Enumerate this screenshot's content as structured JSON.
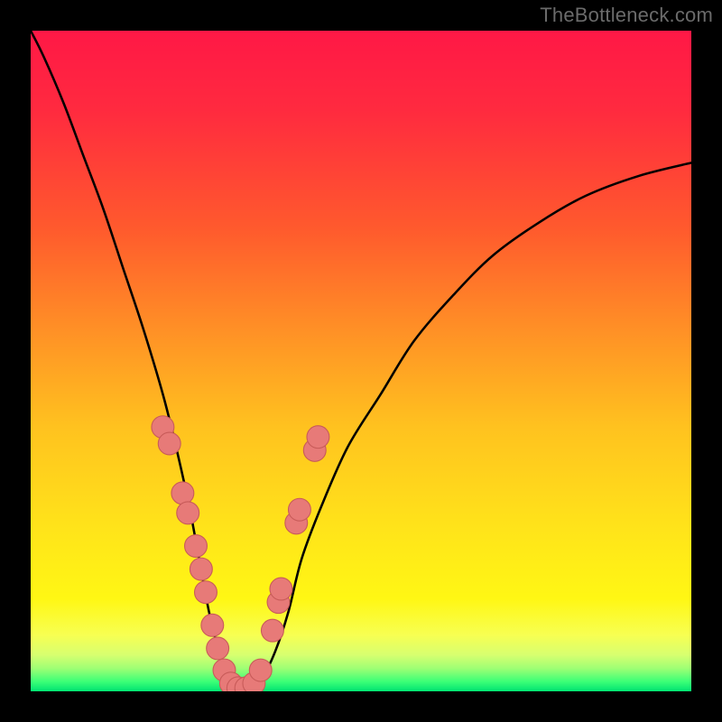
{
  "attribution": "TheBottleneck.com",
  "colors": {
    "frame": "#000000",
    "gradient_stops": [
      {
        "offset": 0.0,
        "color": "#ff1846"
      },
      {
        "offset": 0.12,
        "color": "#ff2a3f"
      },
      {
        "offset": 0.3,
        "color": "#ff5a2d"
      },
      {
        "offset": 0.45,
        "color": "#ff8f26"
      },
      {
        "offset": 0.6,
        "color": "#ffc21f"
      },
      {
        "offset": 0.75,
        "color": "#ffe31a"
      },
      {
        "offset": 0.86,
        "color": "#fff714"
      },
      {
        "offset": 0.915,
        "color": "#f7ff52"
      },
      {
        "offset": 0.945,
        "color": "#d7ff70"
      },
      {
        "offset": 0.965,
        "color": "#9fff74"
      },
      {
        "offset": 0.985,
        "color": "#3dff77"
      },
      {
        "offset": 1.0,
        "color": "#00e472"
      }
    ],
    "curve": "#000000",
    "marker_fill": "#e77a78",
    "marker_stroke": "#c85b59"
  },
  "chart_data": {
    "type": "line",
    "title": "",
    "xlabel": "",
    "ylabel": "",
    "xlim": [
      0,
      100
    ],
    "ylim": [
      0,
      100
    ],
    "series": [
      {
        "name": "bottleneck-curve",
        "x": [
          0,
          2,
          5,
          8,
          11,
          14,
          17,
          20,
          22,
          24,
          25.5,
          27,
          28.5,
          30,
          31.5,
          33,
          35,
          37,
          39,
          41,
          44,
          48,
          53,
          58,
          64,
          70,
          77,
          84,
          92,
          100
        ],
        "y": [
          100,
          96,
          89,
          81,
          73,
          64,
          55,
          45,
          37,
          28,
          20,
          12,
          6,
          2,
          0.5,
          0.5,
          2,
          6,
          12,
          20,
          28,
          37,
          45,
          53,
          60,
          66,
          71,
          75,
          78,
          80
        ]
      }
    ],
    "markers": [
      {
        "x": 20.0,
        "y": 40.0
      },
      {
        "x": 21.0,
        "y": 37.5
      },
      {
        "x": 23.0,
        "y": 30.0
      },
      {
        "x": 23.8,
        "y": 27.0
      },
      {
        "x": 25.0,
        "y": 22.0
      },
      {
        "x": 25.8,
        "y": 18.5
      },
      {
        "x": 26.5,
        "y": 15.0
      },
      {
        "x": 27.5,
        "y": 10.0
      },
      {
        "x": 28.3,
        "y": 6.5
      },
      {
        "x": 29.3,
        "y": 3.2
      },
      {
        "x": 30.3,
        "y": 1.2
      },
      {
        "x": 31.4,
        "y": 0.5
      },
      {
        "x": 32.6,
        "y": 0.5
      },
      {
        "x": 33.8,
        "y": 1.2
      },
      {
        "x": 34.8,
        "y": 3.2
      },
      {
        "x": 36.6,
        "y": 9.2
      },
      {
        "x": 37.5,
        "y": 13.5
      },
      {
        "x": 37.9,
        "y": 15.5
      },
      {
        "x": 40.2,
        "y": 25.5
      },
      {
        "x": 40.7,
        "y": 27.5
      },
      {
        "x": 43.0,
        "y": 36.5
      },
      {
        "x": 43.5,
        "y": 38.5
      }
    ],
    "marker_radius_pct": 1.7
  }
}
